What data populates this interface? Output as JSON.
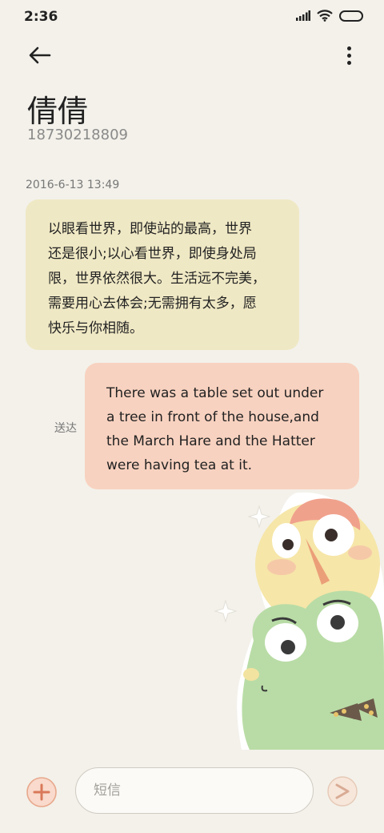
{
  "status_bar": {
    "time": "2:36",
    "icons": [
      "signal-icon",
      "wifi-icon",
      "battery-icon"
    ]
  },
  "header": {
    "back_icon": "arrow-left-icon",
    "more_icon": "more-vertical-icon"
  },
  "contact": {
    "name": "倩倩",
    "number": "18730218809"
  },
  "conversation": {
    "timestamp": "2016-6-13 13:49",
    "incoming": {
      "lines": [
        "以眼看世界，即使站的最高，世界",
        "还是很小;以心看世界，即使身处局",
        "限，世界依然很大。生活远不完美，",
        "需要用心去体会;无需拥有太多，愿",
        "快乐与你相随。"
      ]
    },
    "outgoing": {
      "lines": [
        "There was a table set out under",
        "a tree in front of the house,and",
        "the March Hare and the Hatter",
        "were having tea at it."
      ],
      "status": "送达"
    }
  },
  "compose": {
    "placeholder": "短信",
    "value": ""
  },
  "colors": {
    "background": "#f3f1ea",
    "incoming_bubble": "#efe8c4",
    "outgoing_bubble": "#f8d2c0",
    "accent": "#e8a88c"
  }
}
